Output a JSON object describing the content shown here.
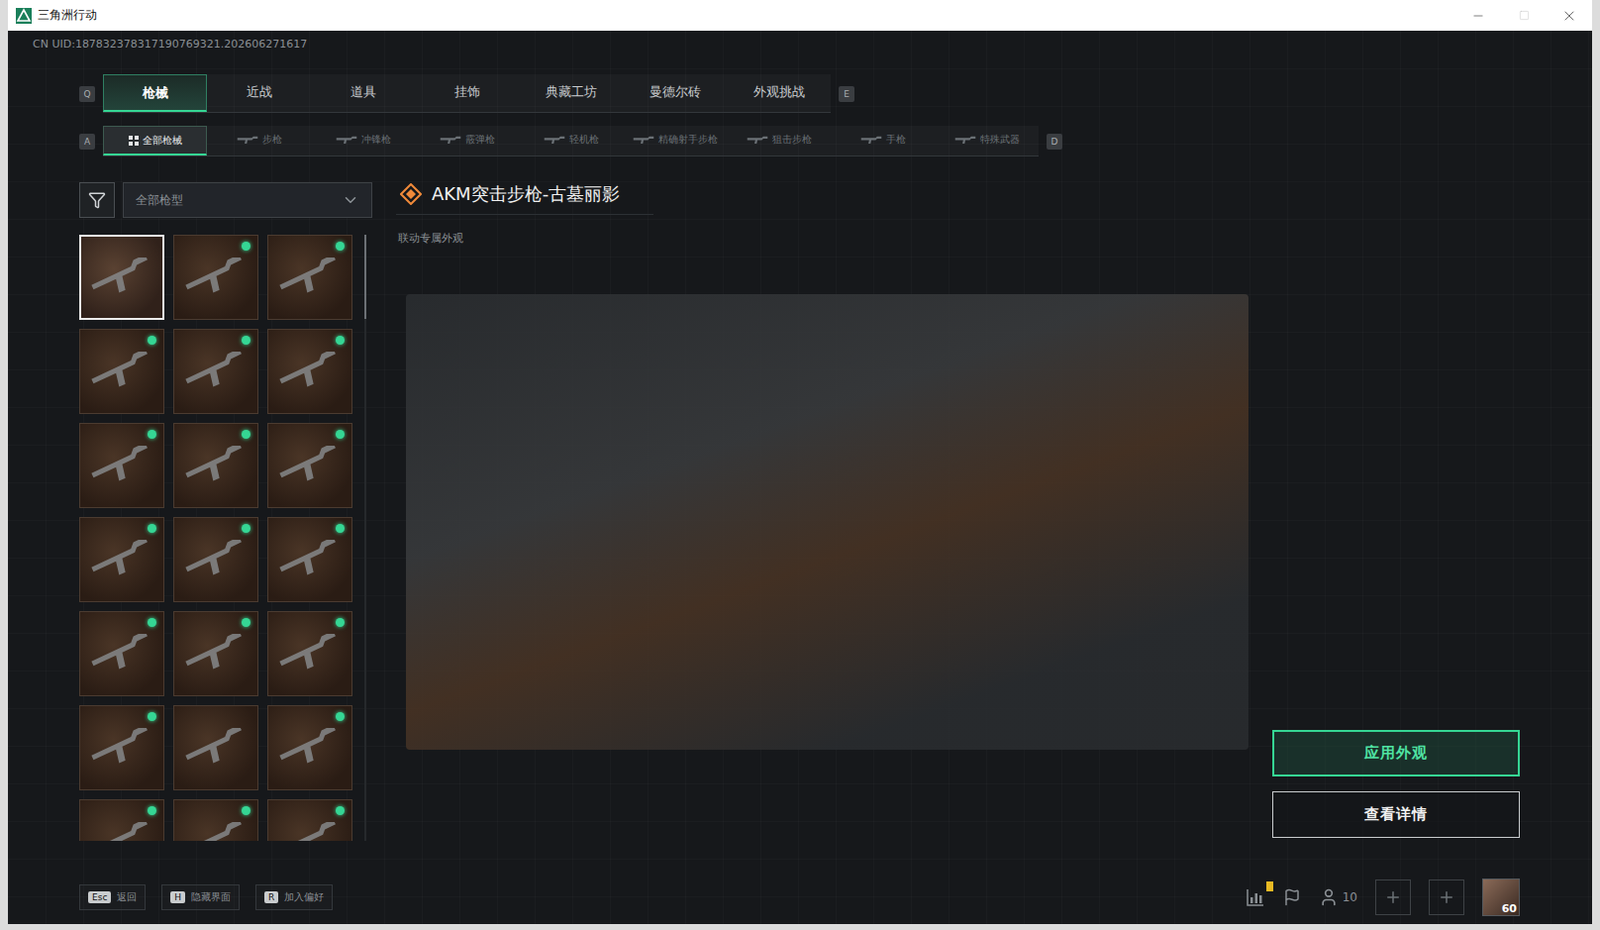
{
  "window": {
    "title": "三角洲行动",
    "controls": [
      "minimize",
      "maximize",
      "close"
    ]
  },
  "uid": "CN UID:187832378317190769321.202606271617",
  "tabs": {
    "prev_key": "Q",
    "next_key": "E",
    "items": [
      {
        "label": "枪械",
        "selected": true
      },
      {
        "label": "近战",
        "selected": false
      },
      {
        "label": "道具",
        "selected": false
      },
      {
        "label": "挂饰",
        "selected": false
      },
      {
        "label": "典藏工坊",
        "selected": false
      },
      {
        "label": "曼德尔砖",
        "selected": false
      },
      {
        "label": "外观挑战",
        "selected": false
      }
    ]
  },
  "subtabs": {
    "prev_key": "A",
    "next_key": "D",
    "items": [
      {
        "label": "全部枪械",
        "selected": true
      },
      {
        "label": "步枪",
        "selected": false
      },
      {
        "label": "冲锋枪",
        "selected": false
      },
      {
        "label": "霰弹枪",
        "selected": false
      },
      {
        "label": "轻机枪",
        "selected": false
      },
      {
        "label": "精确射手步枪",
        "selected": false
      },
      {
        "label": "狙击步枪",
        "selected": false
      },
      {
        "label": "手枪",
        "selected": false
      },
      {
        "label": "特殊武器",
        "selected": false
      }
    ]
  },
  "filter": {
    "value": "全部枪型"
  },
  "skins": [
    {
      "selected": true,
      "new": false
    },
    {
      "selected": false,
      "new": true
    },
    {
      "selected": false,
      "new": true
    },
    {
      "selected": false,
      "new": true
    },
    {
      "selected": false,
      "new": true
    },
    {
      "selected": false,
      "new": true
    },
    {
      "selected": false,
      "new": true
    },
    {
      "selected": false,
      "new": true
    },
    {
      "selected": false,
      "new": true
    },
    {
      "selected": false,
      "new": true
    },
    {
      "selected": false,
      "new": true
    },
    {
      "selected": false,
      "new": true
    },
    {
      "selected": false,
      "new": true
    },
    {
      "selected": false,
      "new": true
    },
    {
      "selected": false,
      "new": true
    },
    {
      "selected": false,
      "new": true
    },
    {
      "selected": false,
      "new": false
    },
    {
      "selected": false,
      "new": true
    },
    {
      "selected": false,
      "new": true
    },
    {
      "selected": false,
      "new": true
    },
    {
      "selected": false,
      "new": true
    }
  ],
  "detail": {
    "title": "AKM突击步枪-古墓丽影",
    "subtitle": "联动专属外观"
  },
  "actions": [
    {
      "label": "应用外观",
      "primary": true
    },
    {
      "label": "查看详情",
      "primary": false
    }
  ],
  "hints": [
    {
      "key": "Esc",
      "label": "返回"
    },
    {
      "key": "H",
      "label": "隐藏界面"
    },
    {
      "key": "R",
      "label": "加入偏好"
    }
  ],
  "status": {
    "notification": true,
    "party_count": "10",
    "level": "60"
  }
}
